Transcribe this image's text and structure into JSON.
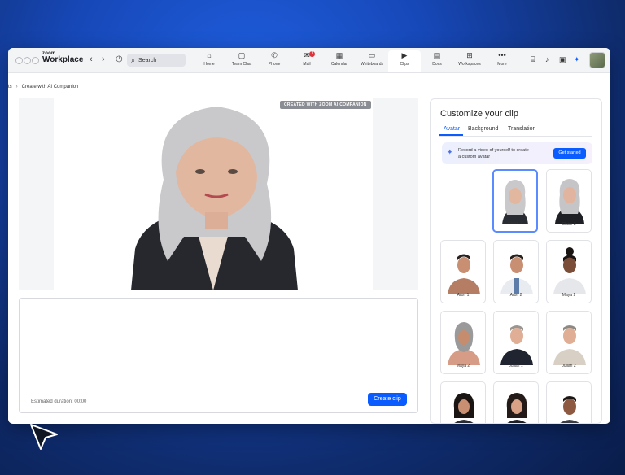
{
  "app": {
    "logo_line1": "zoom",
    "logo_line2": "Workplace"
  },
  "search": {
    "placeholder": "Search"
  },
  "nav_tabs": [
    {
      "label": "Home",
      "icon": "home-icon"
    },
    {
      "label": "Team Chat",
      "icon": "chat-icon"
    },
    {
      "label": "Phone",
      "icon": "phone-icon"
    },
    {
      "label": "Mail",
      "icon": "mail-icon",
      "badge": "1"
    },
    {
      "label": "Calendar",
      "icon": "calendar-icon"
    },
    {
      "label": "Whiteboards",
      "icon": "whiteboard-icon"
    },
    {
      "label": "Clips",
      "icon": "clips-icon",
      "active": true
    },
    {
      "label": "Docs",
      "icon": "docs-icon"
    },
    {
      "label": "Workspaces",
      "icon": "workspaces-icon"
    },
    {
      "label": "More",
      "icon": "more-icon"
    }
  ],
  "breadcrumb": {
    "prev": "ts",
    "current": "Create with AI Companion"
  },
  "preview": {
    "watermark": "CREATED WITH ZOOM AI COMPANION"
  },
  "editor": {
    "duration": "Estimated duration: 00:00",
    "create_button": "Create clip"
  },
  "panel": {
    "title": "Customize your clip",
    "tabs": [
      "Avatar",
      "Background",
      "Translation"
    ],
    "active_tab": "Avatar",
    "promo_text": "Record a video of yourself to create a custom avatar",
    "promo_button": "Get started",
    "avatars": [
      {
        "name": "Claire 1",
        "selected": true
      },
      {
        "name": "Claire 2"
      },
      {
        "name": "Aron 1"
      },
      {
        "name": "Aron 2"
      },
      {
        "name": "Maya 1"
      },
      {
        "name": "Maya 2"
      },
      {
        "name": "Julian 1"
      },
      {
        "name": "Julian 2"
      },
      {
        "name": ""
      },
      {
        "name": ""
      },
      {
        "name": ""
      }
    ]
  },
  "colors": {
    "accent": "#0b5cff",
    "background": "#1748b8"
  }
}
